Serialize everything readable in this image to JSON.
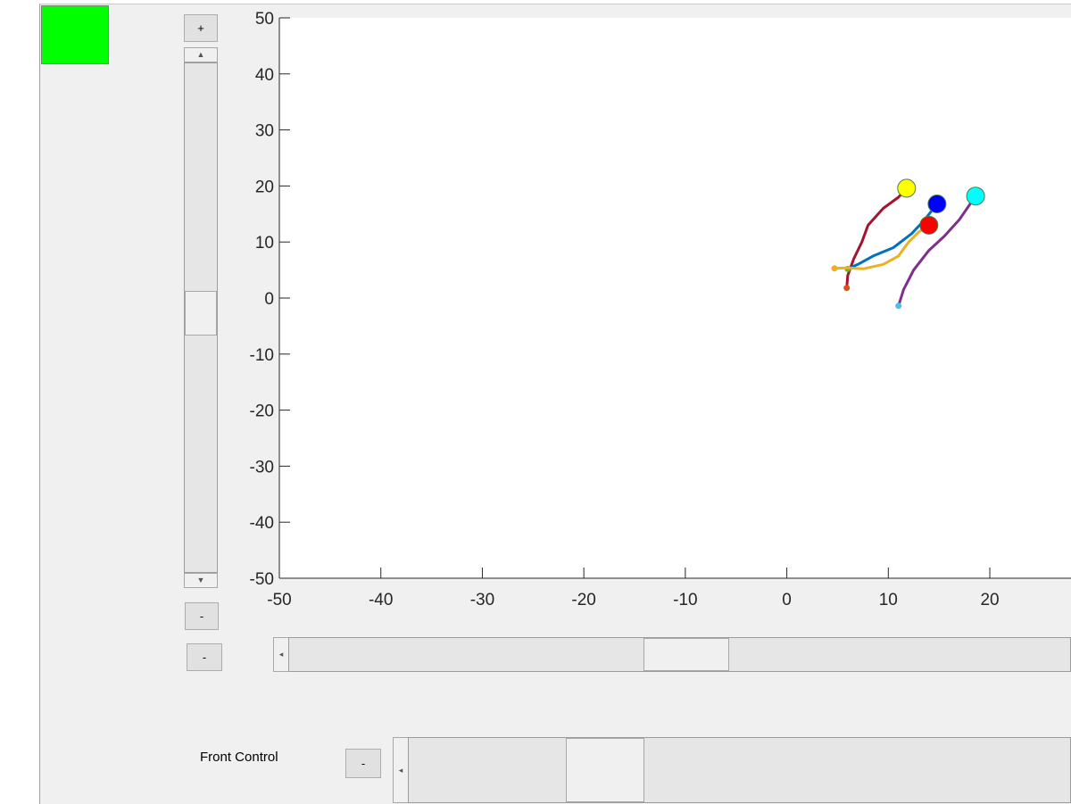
{
  "window": {
    "status_color": "#00ff00"
  },
  "vertical_zoom": {
    "plus_label": "+",
    "up_arrow": "▲",
    "down_arrow": "▼",
    "position_fraction": 0.49
  },
  "side_buttons": {
    "minus_label_1": "-",
    "minus_label_2": "-"
  },
  "horizontal_slider": {
    "left_arrow": "◂",
    "position_fraction": 0.51
  },
  "front_control": {
    "label": "Front Control",
    "minus_label": "-",
    "left_arrow": "◂",
    "position_fraction": 0.27
  },
  "chart_data": {
    "type": "line",
    "title": "",
    "xlabel": "",
    "ylabel": "",
    "xlim": [
      -50,
      28
    ],
    "ylim": [
      -50,
      50
    ],
    "xticks": [
      -50,
      -40,
      -30,
      -20,
      -10,
      0,
      10,
      20
    ],
    "yticks": [
      50,
      40,
      30,
      20,
      10,
      0,
      -10,
      -20,
      -30,
      -40,
      -50
    ],
    "grid": false,
    "series": [
      {
        "color": "#A2142F",
        "start_color": "#D95319",
        "end_color": "#FFFF00",
        "points": [
          [
            5.9,
            1.8
          ],
          [
            6.0,
            4.0
          ],
          [
            6.6,
            7.0
          ],
          [
            7.4,
            10.0
          ],
          [
            8.0,
            13.0
          ],
          [
            9.5,
            16.0
          ],
          [
            11.0,
            18.0
          ],
          [
            11.8,
            19.6
          ]
        ]
      },
      {
        "color": "#0072BD",
        "start_color": "#77AC30",
        "end_color": "#0000FF",
        "points": [
          [
            6.0,
            5.2
          ],
          [
            7.0,
            6.0
          ],
          [
            8.5,
            7.5
          ],
          [
            10.5,
            9.0
          ],
          [
            12.3,
            11.5
          ],
          [
            13.6,
            14.0
          ],
          [
            14.8,
            16.8
          ]
        ]
      },
      {
        "color": "#EDB120",
        "start_color": "#EDB120",
        "end_color": "#FF0000",
        "points": [
          [
            4.7,
            5.3
          ],
          [
            6.0,
            5.4
          ],
          [
            7.5,
            5.2
          ],
          [
            9.5,
            6.0
          ],
          [
            11.0,
            7.5
          ],
          [
            12.0,
            10.0
          ],
          [
            13.0,
            11.8
          ],
          [
            14.0,
            13.0
          ]
        ]
      },
      {
        "color": "#7E2F8E",
        "start_color": "#4DBEEE",
        "end_color": "#00FFFF",
        "points": [
          [
            11.0,
            -1.4
          ],
          [
            11.5,
            1.5
          ],
          [
            12.5,
            5.0
          ],
          [
            14.0,
            8.5
          ],
          [
            15.5,
            11.0
          ],
          [
            17.0,
            14.0
          ],
          [
            18.6,
            18.2
          ]
        ]
      }
    ]
  }
}
